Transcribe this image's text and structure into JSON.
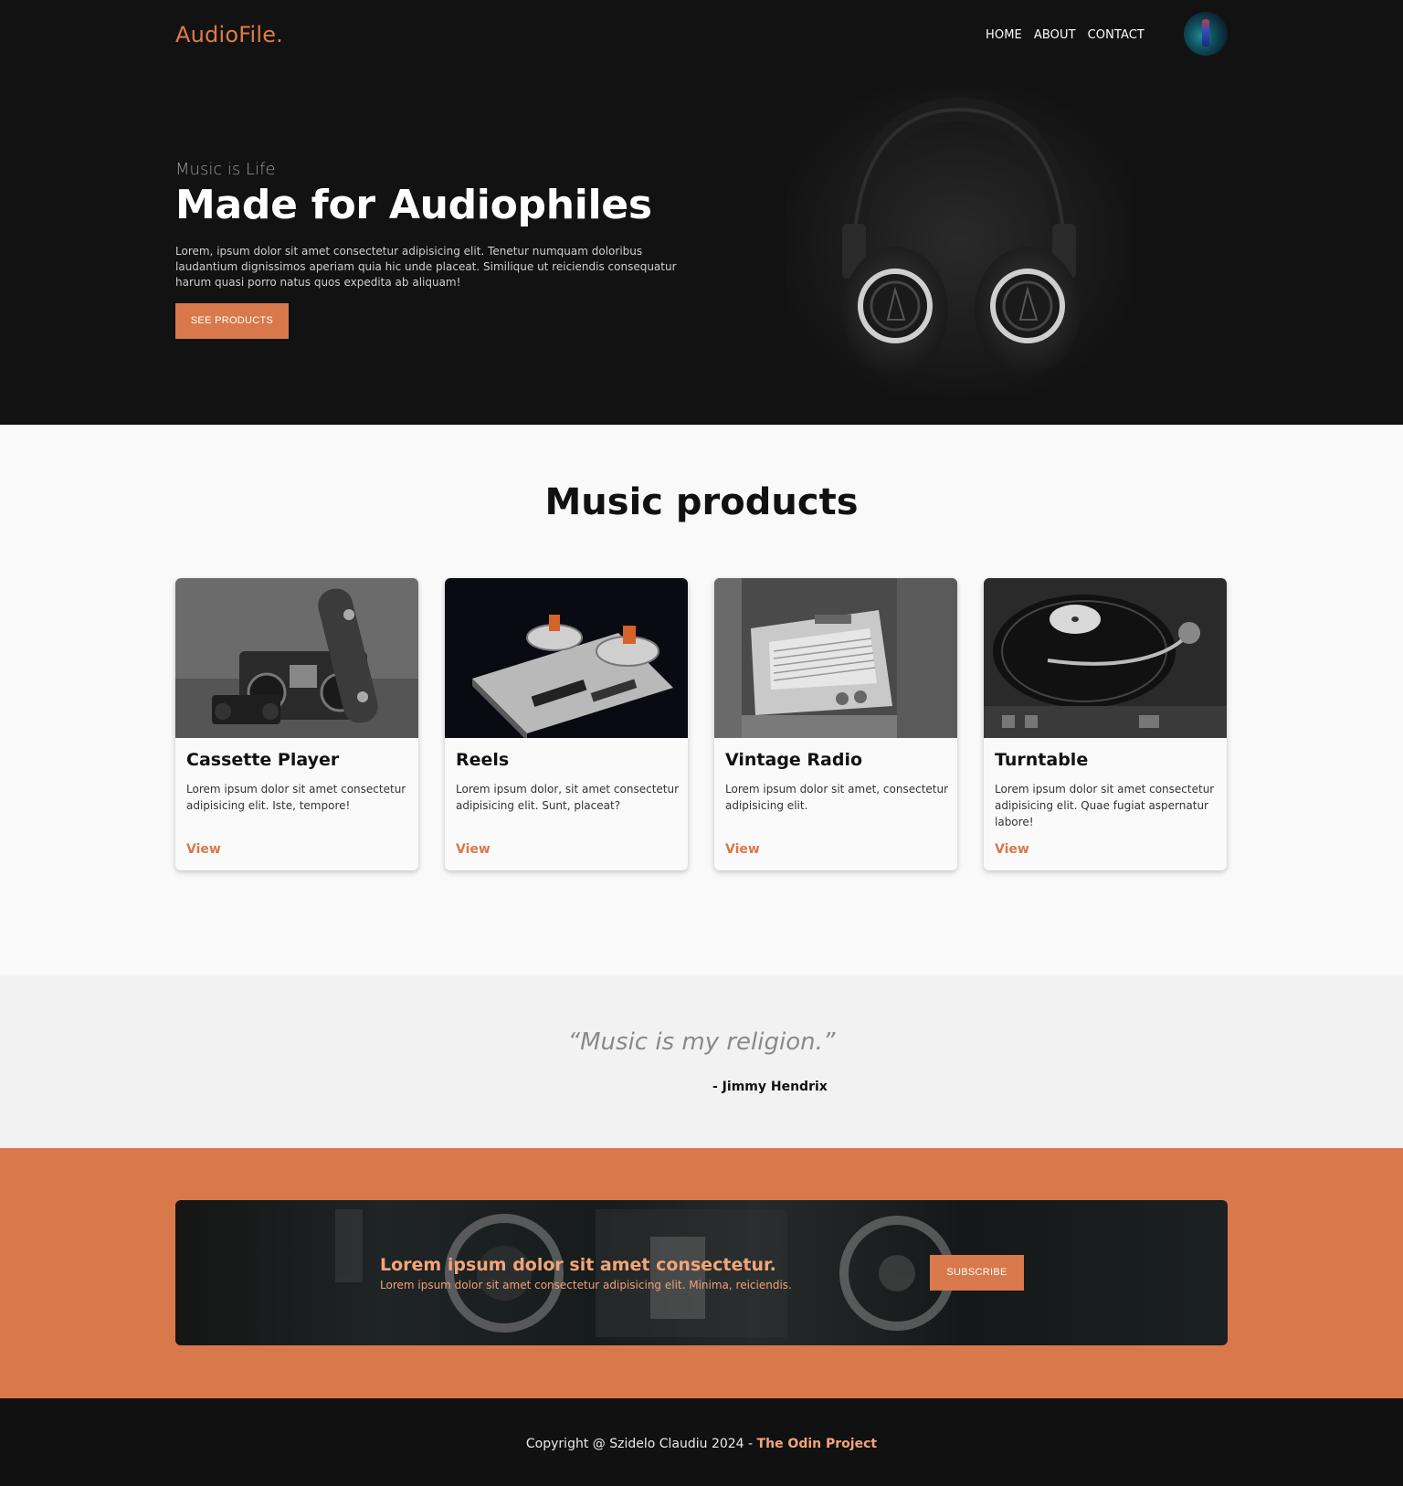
{
  "header": {
    "logo": "AudioFile.",
    "nav": [
      "HOME",
      "ABOUT",
      "CONTACT"
    ]
  },
  "hero": {
    "kicker": "Music is Life",
    "title": "Made for Audiophiles",
    "body": "Lorem, ipsum dolor sit amet consectetur adipisicing elit. Tenetur numquam doloribus laudantium dignissimos aperiam quia hic unde placeat. Similique ut reiciendis consequatur harum quasi porro natus quos expedita ab aliquam!",
    "button": "SEE PRODUCTS"
  },
  "products": {
    "title": "Music products",
    "items": [
      {
        "title": "Cassette Player",
        "desc": "Lorem ipsum dolor sit amet consectetur adipisicing elit. Iste, tempore!",
        "link": "View"
      },
      {
        "title": "Reels",
        "desc": "Lorem ipsum dolor, sit amet consectetur adipisicing elit. Sunt, placeat?",
        "link": "View"
      },
      {
        "title": "Vintage Radio",
        "desc": "Lorem ipsum dolor sit amet, consectetur adipisicing elit.",
        "link": "View"
      },
      {
        "title": "Turntable",
        "desc": "Lorem ipsum dolor sit amet consectetur adipisicing elit. Quae fugiat aspernatur labore!",
        "link": "View"
      }
    ]
  },
  "quote": {
    "text": "“Music is my religion.”",
    "author": "- Jimmy Hendrix"
  },
  "subscribe": {
    "title": "Lorem ipsum dolor sit amet consectetur.",
    "text": "Lorem ipsum dolor sit amet consectetur adipisicing elit. Minima, reiciendis.",
    "button": "SUBSCRIBE"
  },
  "footer": {
    "text": "Copyright @ Szidelo Claudiu 2024 - ",
    "link": "The Odin Project"
  },
  "colors": {
    "accent": "#d9784a",
    "dark": "#121212",
    "light": "#f9f9f9"
  }
}
